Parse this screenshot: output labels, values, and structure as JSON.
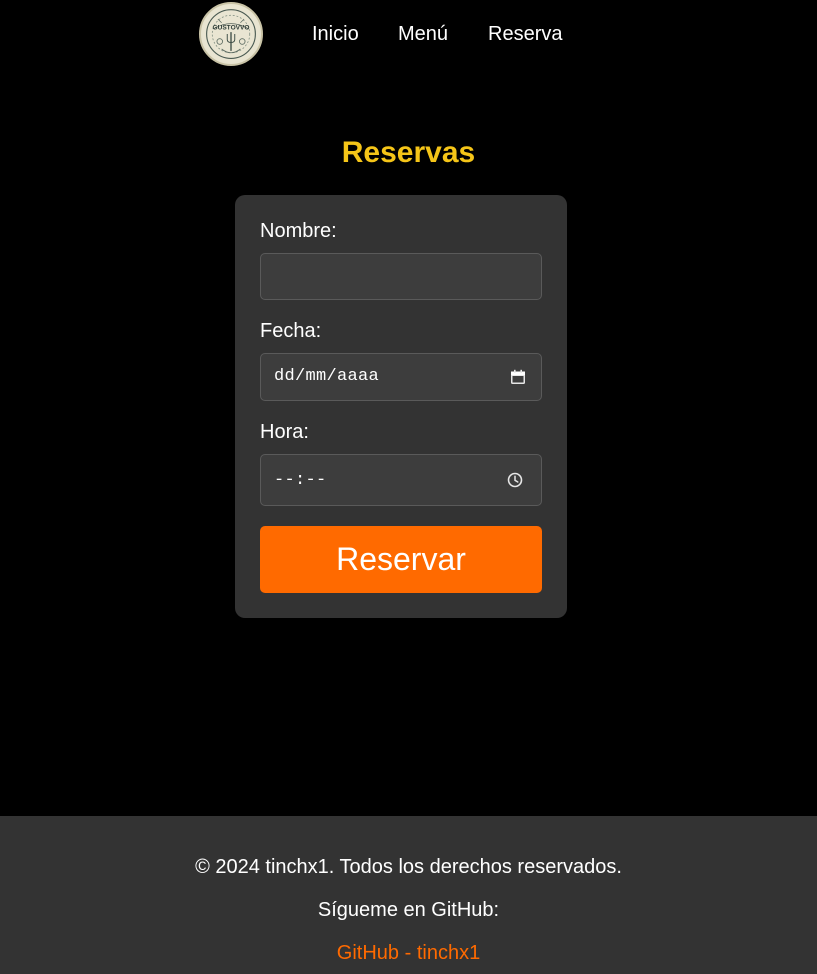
{
  "colors": {
    "background": "#000000",
    "title": "#f5c518",
    "card": "#333333",
    "input": "#3d3d3d",
    "accent": "#ff6a00",
    "footer": "#333333",
    "text": "#ffffff"
  },
  "header": {
    "logo_icon": "gustovvo-logo",
    "logo_text": "GUSTOVVO",
    "nav": [
      {
        "label": "Inicio"
      },
      {
        "label": "Menú"
      },
      {
        "label": "Reserva"
      }
    ]
  },
  "main": {
    "title": "Reservas",
    "form": {
      "nombre": {
        "label": "Nombre:",
        "value": ""
      },
      "fecha": {
        "label": "Fecha:",
        "placeholder": "dd/mm/aaaa",
        "icon": "calendar-icon"
      },
      "hora": {
        "label": "Hora:",
        "placeholder": "--:--",
        "icon": "clock-icon"
      },
      "submit_label": "Reservar"
    }
  },
  "footer": {
    "copyright": "© 2024 tinchx1. Todos los derechos reservados.",
    "follow_text": "Sígueme en GitHub:",
    "link_label": "GitHub - tinchx1"
  }
}
